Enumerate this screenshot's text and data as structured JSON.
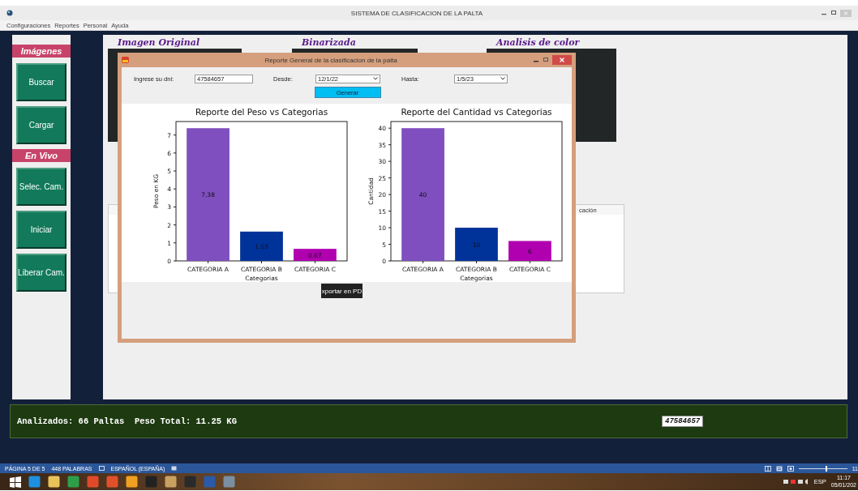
{
  "window": {
    "title": "SISTEMA DE CLASIFICACION DE LA PALTA"
  },
  "menu": [
    "Configuraciones",
    "Reportes",
    "Personal",
    "Ayuda"
  ],
  "sidebar": {
    "sections": [
      {
        "title": "Imágenes",
        "buttons": [
          "Buscar",
          "Cargar"
        ]
      },
      {
        "title": "En Vivo",
        "buttons": [
          "Selec. Cam.",
          "Iniciar",
          "Liberar Cam."
        ]
      }
    ]
  },
  "image_panels": [
    {
      "title": "Imagen Original"
    },
    {
      "title": "Binarizada"
    },
    {
      "title": "Analisis de color"
    }
  ],
  "table": {
    "columns": [
      "cación"
    ]
  },
  "status_panel": {
    "summary": "Analizados: 66 Paltas  Peso Total: 11.25 KG",
    "dni": "47584657"
  },
  "dialog": {
    "title": "Reporte General de la clasificacion de la palta",
    "dni_label": "Ingrese su dni:",
    "dni_value": "47584657",
    "desde_label": "Desde:",
    "desde_value": "12/1/22",
    "hasta_label": "Hasta:",
    "hasta_value": "1/5/23",
    "generate_button": "Generar",
    "charts": [
      {
        "chart_data": {
          "type": "bar",
          "title": "Reporte del Peso vs Categorias",
          "xlabel": "Categorias",
          "ylabel": "Peso en KG",
          "categories": [
            "CATEGORIA A",
            "CATEGORIA B",
            "CATEGORIA C"
          ],
          "colors": [
            "#7f4fbf",
            "#003399",
            "#b000b0"
          ],
          "series": [
            {
              "values": [
                7.38,
                1.63,
                0.67
              ]
            }
          ],
          "ylim": [
            0,
            7.75
          ],
          "yticks": [
            0,
            1,
            2,
            3,
            4,
            5,
            6,
            7
          ],
          "data_labels": true
        }
      },
      {
        "chart_data": {
          "type": "bar",
          "title": "Reporte del Cantidad vs Categorias",
          "xlabel": "Categorias",
          "ylabel": "Cantidad",
          "categories": [
            "CATEGORIA A",
            "CATEGORIA B",
            "CATEGORIA C"
          ],
          "colors": [
            "#7f4fbf",
            "#003399",
            "#b000b0"
          ],
          "series": [
            {
              "values": [
                40,
                10,
                6
              ]
            }
          ],
          "ylim": [
            0,
            42
          ],
          "yticks": [
            0,
            5,
            10,
            15,
            20,
            25,
            30,
            35,
            40
          ],
          "data_labels": true
        }
      }
    ],
    "export_button": "xportar en PD"
  },
  "word_status_bar": {
    "page": "PÁGINA 5 DE 5",
    "words": "448 PALABRAS",
    "language": "ESPAÑOL (ESPAÑA)",
    "zoom_slider": {
      "level": 0.55
    },
    "zoom_percent": "11"
  },
  "taskbar": {
    "language": "ESP",
    "time": "11:17",
    "date": "05/01/202"
  }
}
